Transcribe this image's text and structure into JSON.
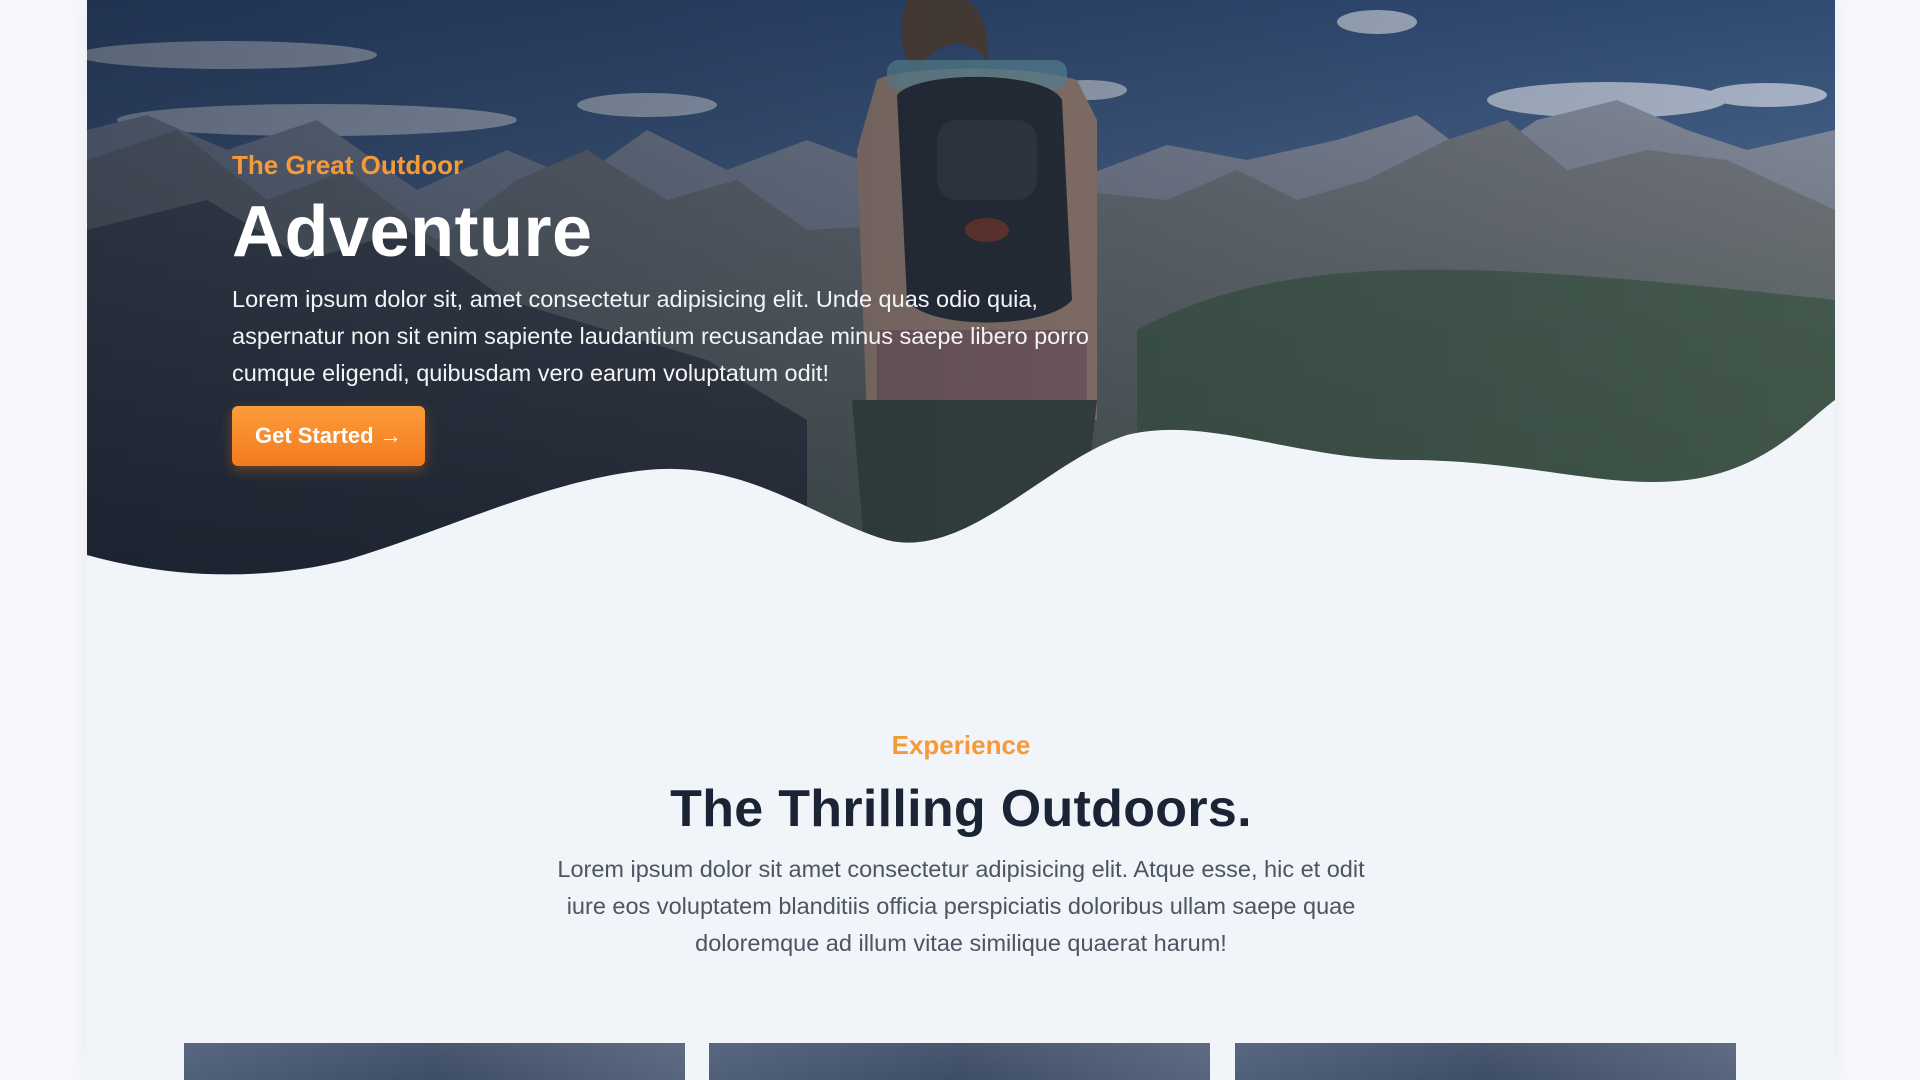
{
  "hero": {
    "eyebrow": "The Great Outdoor",
    "title": "Adventure",
    "description": "Lorem ipsum dolor sit, amet consectetur adipisicing elit. Unde quas odio quia, aspernatur non sit enim sapiente laudantium recusandae minus saepe libero porro cumque eligendi, quibusdam vero earum voluptatum odit!",
    "cta_label": "Get Started →"
  },
  "experience": {
    "eyebrow": "Experience",
    "title": "The Thrilling Outdoors.",
    "description": "Lorem ipsum dolor sit amet consectetur adipisicing elit. Atque esse, hic et odit iure eos voluptatem blanditiis officia perspiciatis doloribus ullam saepe quae doloremque ad illum vitae similique quaerat harum!"
  },
  "colors": {
    "accent": "#f59a3a",
    "button": "#f47b1e",
    "heading_dark": "#1b2435",
    "background": "#f1f4f8"
  }
}
